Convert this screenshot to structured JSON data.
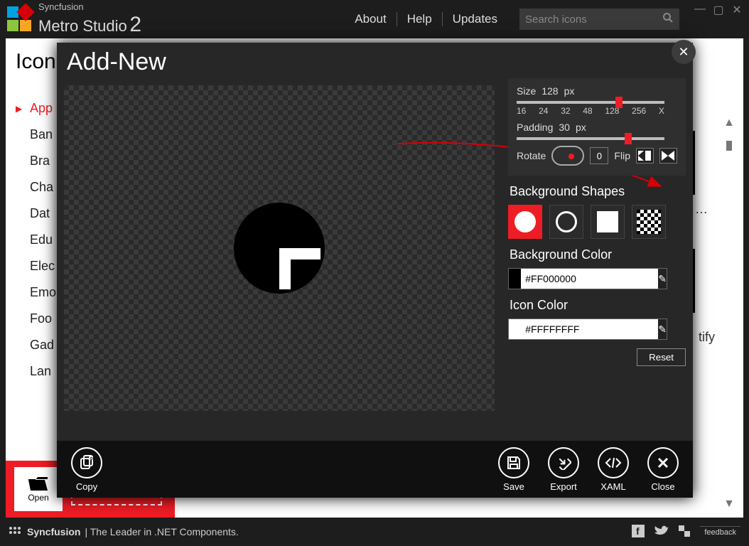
{
  "app": {
    "vendor": "Syncfusion",
    "name": "Metro Studio",
    "version": "2"
  },
  "topnav": {
    "about": "About",
    "help": "Help",
    "updates": "Updates"
  },
  "search": {
    "placeholder": "Search icons"
  },
  "page": {
    "title_prefix": "Icon"
  },
  "categories": [
    "App",
    "Ban",
    "Bra",
    "Cha",
    "Dat",
    "Edu",
    "Elec",
    "Emo",
    "Foo",
    "Gad",
    "Lan"
  ],
  "bg_labels": {
    "ellipsis": "…",
    "identify": "tify"
  },
  "open_project": {
    "open": "Open"
  },
  "footer": {
    "brand": "Syncfusion",
    "tagline": "| The Leader in .NET Components.",
    "feedback": "feedback"
  },
  "dialog": {
    "title": "Add-New",
    "size": {
      "label": "Size",
      "value": "128",
      "unit": "px",
      "ticks": [
        "16",
        "24",
        "32",
        "48",
        "128",
        "256",
        "X"
      ],
      "handle_pct": 67
    },
    "padding": {
      "label": "Padding",
      "value": "30",
      "unit": "px",
      "handle_pct": 73
    },
    "rotate": {
      "label": "Rotate",
      "value": "0"
    },
    "flip": {
      "label": "Flip"
    },
    "bg_shapes_title": "Background Shapes",
    "bg_color_title": "Background Color",
    "bg_color_hex": "#FF000000",
    "icon_color_title": "Icon Color",
    "icon_color_hex": "#FFFFFFFF",
    "reset": "Reset",
    "footer": {
      "copy": "Copy",
      "save": "Save",
      "export": "Export",
      "xaml": "XAML",
      "close": "Close"
    }
  }
}
